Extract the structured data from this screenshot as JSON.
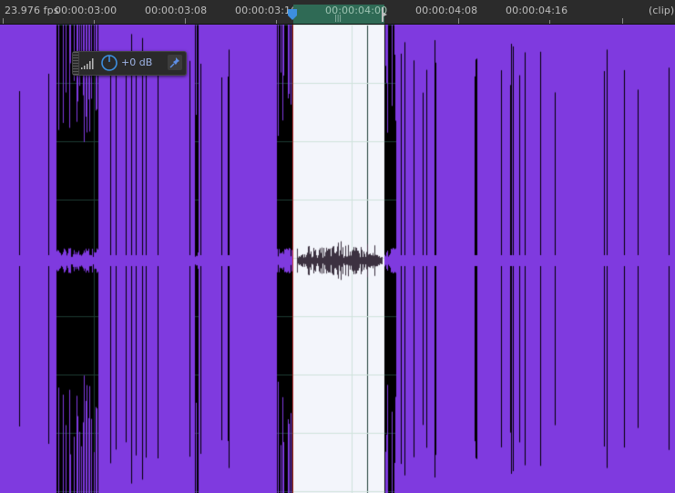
{
  "ruler": {
    "fps": "23.976 fps",
    "timecodes": [
      "00:00:03:00",
      "00:00:03:08",
      "00:00:03:16",
      "00:00:04:00",
      "00:00:04:08",
      "00:00:04:16"
    ],
    "clip_label": "(clip)"
  },
  "gain_control": {
    "value": "+0 dB",
    "icons": [
      "volume-meter-icon",
      "gain-knob-icon",
      "pin-icon"
    ]
  },
  "colors": {
    "waveform": "#7f3adf",
    "selection": "#f3f5fb",
    "background": "#000000",
    "ruler_bg": "#2b2b2b",
    "selection_range": "#2f6a55",
    "playhead": "#3d8fe0",
    "gridline": "#1c3b33"
  }
}
